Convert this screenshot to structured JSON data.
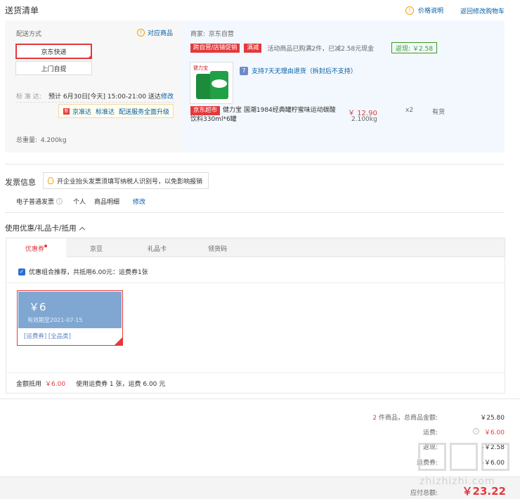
{
  "header": {
    "title": "送货清单",
    "price_note_label": "价格说明",
    "back_to_cart": "返回修改购物车"
  },
  "delivery": {
    "method_label": "配送方式",
    "products_link": "对应商品",
    "options": [
      "京东快递",
      "上门自提"
    ],
    "standard_label": "标 准 达:",
    "standard_text": "预计 6月30日[今天] 15:00-21:00 送达",
    "edit": "修改",
    "upgrade_badges": [
      "京准达",
      "标准达"
    ],
    "upgrade_text": "配送服务全面升级",
    "total_weight_label": "总重量:",
    "total_weight": "4.200kg"
  },
  "shop": {
    "merchant_label": "商家:",
    "merchant_name": "京东自营",
    "promo_tags": [
      "跨自营/店铺促销",
      "满减"
    ],
    "promo_text": "活动商品已购满2件，已减2.58元现金",
    "cashback_label": "返现:",
    "cashback_value": "￥2.58",
    "return_policy": "支持7天无理由退货（拆封后不支持）",
    "supermarket_tag": "京东超市",
    "product_name": "健力宝 国潮1984经典罐柠蜜味运动碳酸饮料330ml*6罐",
    "price": "￥ 12.90",
    "quantity": "x2",
    "stock": "有货",
    "weight": "2.100kg",
    "product_image_text": "健力宝"
  },
  "invoice": {
    "title": "发票信息",
    "tip": "开企业抬头发票须填写纳税人识别号，以免影响报销",
    "type": "电子普通发票",
    "individual": "个人",
    "detail": "商品明细",
    "edit": "修改"
  },
  "coupons": {
    "title": "使用优惠/礼品卡/抵用",
    "tabs": [
      "优惠券",
      "京豆",
      "礼品卡",
      "领货码"
    ],
    "combo_text": "优惠组合推荐，共抵用6.00元：运费券1张",
    "coupon_amount": "￥6",
    "coupon_validity": "有效期至2021-07-15",
    "coupon_tags": [
      "[运费券]",
      "[全品类]"
    ],
    "summary_label": "金额抵用",
    "summary_amount": "￥6.00",
    "summary_text": "使用运费券 1 张，运费 6.00 元"
  },
  "totals": {
    "count": "2",
    "count_suffix": "件商品，总商品金额:",
    "goods_amount": "￥25.80",
    "shipping_label": "运费:",
    "shipping_amount": "￥6.00",
    "rebate_label": "返现:",
    "rebate_amount": "-￥2.58",
    "shipping_coupon_label": "运费券:",
    "shipping_coupon_amount": "-￥6.00",
    "payable_label": "应付总额:",
    "payable_amount": "￥23.22"
  },
  "watermark": {
    "text": "zhizhizhi.com"
  },
  "colors": {
    "accent_red": "#e4393c",
    "link_blue": "#005ea7",
    "panel_blue": "#f3f8fe",
    "coupon_blue": "#7fa7d2",
    "cashback_green": "#3b9a22"
  }
}
